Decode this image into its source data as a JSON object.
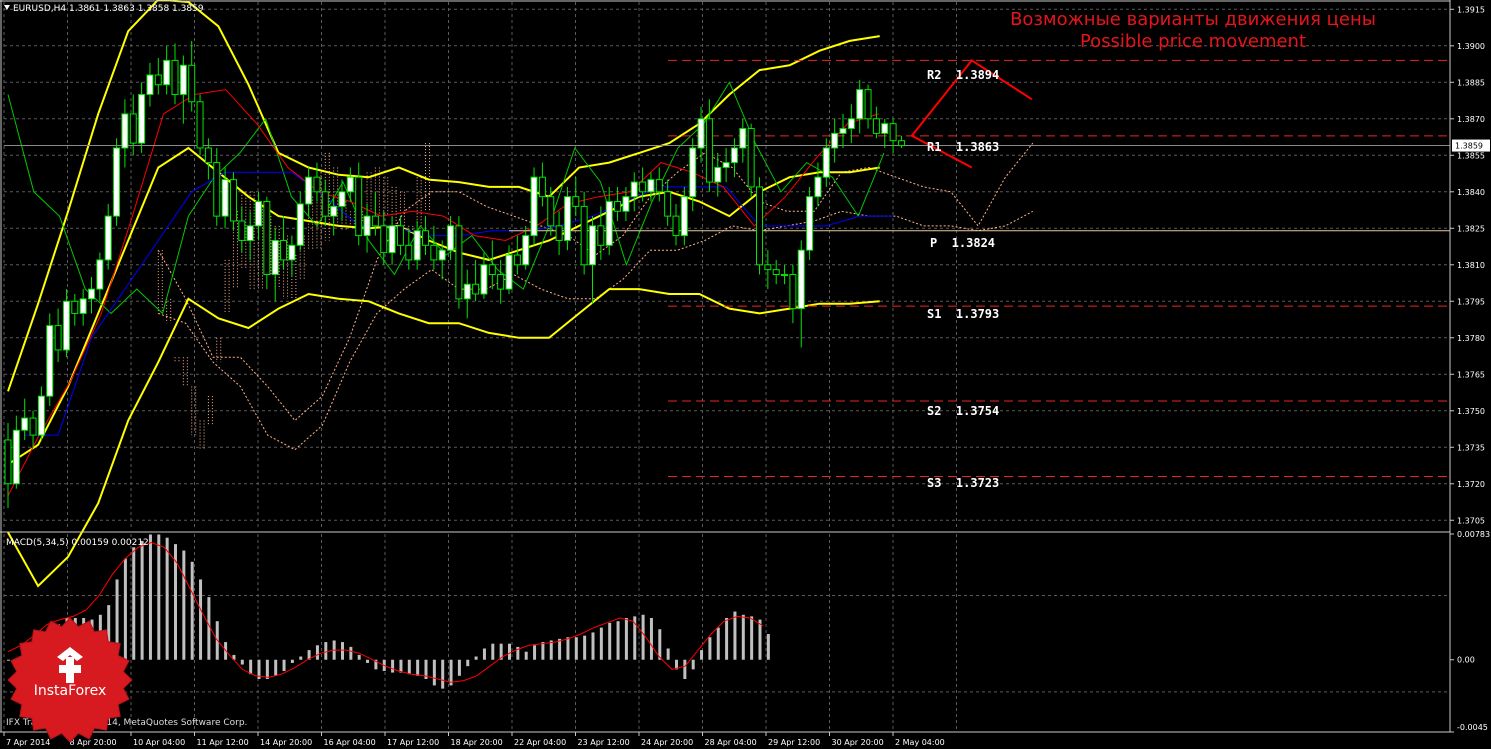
{
  "window": {
    "symbol": "EURUSD,H4",
    "ohlc": "1.3861 1.3863 1.3858 1.3859",
    "current_price": "1.3859"
  },
  "colors": {
    "background": "#000000",
    "grid": "#5a5a5a",
    "axis": "#c8c8c8",
    "bull_candle_fill": "#ffffff",
    "bear_candle_fill": "#000000",
    "candle_outline": "#00e600",
    "bollinger": "#ffff00",
    "tenkan": "#ff0000",
    "kijun": "#0000ff",
    "chikou": "#00c800",
    "cloud": "#ffb48c",
    "pivot_lines": "#e62626",
    "forecast": "#ff0000",
    "macd_hist": "#c0c0c0",
    "macd_signal": "#ff0000",
    "forecast_title": "#e6141c"
  },
  "price_axis": {
    "ticks": [
      "1.3915",
      "1.3900",
      "1.3885",
      "1.3870",
      "1.3855",
      "1.3840",
      "1.3825",
      "1.3810",
      "1.3795",
      "1.3780",
      "1.3765",
      "1.3750",
      "1.3735",
      "1.3720",
      "1.3705"
    ],
    "range": [
      1.3701,
      1.3918
    ]
  },
  "time_axis": {
    "labels": [
      "7 Apr 2014",
      "8 Apr 20:00",
      "10 Apr 04:00",
      "11 Apr 12:00",
      "14 Apr 20:00",
      "16 Apr 04:00",
      "17 Apr 12:00",
      "18 Apr 20:00",
      "22 Apr 04:00",
      "23 Apr 12:00",
      "24 Apr 20:00",
      "28 Apr 04:00",
      "29 Apr 12:00",
      "30 Apr 20:00",
      "2 May 04:00"
    ]
  },
  "forecast_title": {
    "ru": "Возможные варианты движения цены",
    "en": "Possible price movement"
  },
  "pivots": [
    {
      "label": "R2  1.3894",
      "value": 1.3894
    },
    {
      "label": "R1  1.3863",
      "value": 1.3863
    },
    {
      "label": "P  1.3824",
      "value": 1.3824
    },
    {
      "label": "S1  1.3793",
      "value": 1.3793
    },
    {
      "label": "S2  1.3754",
      "value": 1.3754
    },
    {
      "label": "S3  1.3723",
      "value": 1.3723
    }
  ],
  "macd": {
    "label": "MACD(5,34,5) 0.00159 0.00212",
    "axis_ticks": [
      "0.00783",
      "0.00",
      "-0.0045"
    ],
    "range": [
      -0.0045,
      0.00783
    ]
  },
  "footer": {
    "copyright": "IFX Trader, © 2001-2014, MetaQuotes Software Corp."
  },
  "logo": {
    "text": "InstaForex"
  },
  "chart_data": {
    "type": "candlestick",
    "symbol": "EURUSD",
    "timeframe": "H4",
    "ylim": [
      1.3701,
      1.3918
    ],
    "candles": [
      [
        1.3738,
        1.3745,
        1.371,
        1.372
      ],
      [
        1.372,
        1.3748,
        1.3718,
        1.3742
      ],
      [
        1.3742,
        1.3755,
        1.3738,
        1.3747
      ],
      [
        1.3747,
        1.375,
        1.3735,
        1.374
      ],
      [
        1.374,
        1.376,
        1.3738,
        1.3756
      ],
      [
        1.3756,
        1.379,
        1.3752,
        1.3785
      ],
      [
        1.3785,
        1.3792,
        1.377,
        1.3775
      ],
      [
        1.3775,
        1.38,
        1.3772,
        1.3795
      ],
      [
        1.3795,
        1.3798,
        1.3785,
        1.379
      ],
      [
        1.379,
        1.38,
        1.3785,
        1.3796
      ],
      [
        1.3796,
        1.3805,
        1.379,
        1.38
      ],
      [
        1.38,
        1.3815,
        1.3795,
        1.3812
      ],
      [
        1.3812,
        1.3835,
        1.3808,
        1.383
      ],
      [
        1.383,
        1.3862,
        1.3826,
        1.3858
      ],
      [
        1.3858,
        1.3878,
        1.385,
        1.3872
      ],
      [
        1.3872,
        1.388,
        1.3855,
        1.386
      ],
      [
        1.386,
        1.3885,
        1.3856,
        1.388
      ],
      [
        1.388,
        1.3893,
        1.3875,
        1.3888
      ],
      [
        1.3888,
        1.3895,
        1.388,
        1.3884
      ],
      [
        1.3884,
        1.39,
        1.388,
        1.3894
      ],
      [
        1.3894,
        1.3901,
        1.3876,
        1.388
      ],
      [
        1.388,
        1.3896,
        1.3868,
        1.3892
      ],
      [
        1.3892,
        1.3902,
        1.3873,
        1.3877
      ],
      [
        1.3877,
        1.388,
        1.3855,
        1.3858
      ],
      [
        1.3858,
        1.3862,
        1.3845,
        1.3852
      ],
      [
        1.3852,
        1.3858,
        1.3826,
        1.383
      ],
      [
        1.383,
        1.385,
        1.3825,
        1.3845
      ],
      [
        1.3845,
        1.3848,
        1.3824,
        1.3828
      ],
      [
        1.3828,
        1.3834,
        1.3815,
        1.382
      ],
      [
        1.382,
        1.3832,
        1.3812,
        1.3826
      ],
      [
        1.3826,
        1.384,
        1.382,
        1.3836
      ],
      [
        1.3836,
        1.3838,
        1.38,
        1.3806
      ],
      [
        1.3806,
        1.3825,
        1.3795,
        1.382
      ],
      [
        1.382,
        1.383,
        1.3808,
        1.3812
      ],
      [
        1.3812,
        1.3822,
        1.3805,
        1.3818
      ],
      [
        1.3818,
        1.384,
        1.3816,
        1.3835
      ],
      [
        1.3835,
        1.385,
        1.383,
        1.3846
      ],
      [
        1.3846,
        1.3852,
        1.3836,
        1.384
      ],
      [
        1.384,
        1.3845,
        1.3826,
        1.383
      ],
      [
        1.383,
        1.3838,
        1.3822,
        1.3834
      ],
      [
        1.3834,
        1.3845,
        1.3828,
        1.384
      ],
      [
        1.384,
        1.385,
        1.3836,
        1.3846
      ],
      [
        1.3846,
        1.3852,
        1.3818,
        1.3822
      ],
      [
        1.3822,
        1.3835,
        1.3815,
        1.383
      ],
      [
        1.383,
        1.384,
        1.3822,
        1.3826
      ],
      [
        1.3826,
        1.3832,
        1.381,
        1.3815
      ],
      [
        1.3815,
        1.383,
        1.381,
        1.3826
      ],
      [
        1.3826,
        1.383,
        1.3814,
        1.3818
      ],
      [
        1.3818,
        1.3825,
        1.3808,
        1.3812
      ],
      [
        1.3812,
        1.3828,
        1.3808,
        1.3824
      ],
      [
        1.3824,
        1.383,
        1.3814,
        1.3818
      ],
      [
        1.3818,
        1.3826,
        1.3808,
        1.3812
      ],
      [
        1.3812,
        1.382,
        1.3804,
        1.3816
      ],
      [
        1.3816,
        1.383,
        1.3812,
        1.3826
      ],
      [
        1.3826,
        1.383,
        1.3792,
        1.3796
      ],
      [
        1.3796,
        1.3808,
        1.3788,
        1.3802
      ],
      [
        1.3802,
        1.3812,
        1.3795,
        1.3798
      ],
      [
        1.3798,
        1.3815,
        1.3796,
        1.381
      ],
      [
        1.381,
        1.382,
        1.38,
        1.3806
      ],
      [
        1.3806,
        1.3812,
        1.3794,
        1.38
      ],
      [
        1.38,
        1.3818,
        1.3798,
        1.3814
      ],
      [
        1.3814,
        1.3822,
        1.3806,
        1.381
      ],
      [
        1.381,
        1.3826,
        1.3808,
        1.3822
      ],
      [
        1.3822,
        1.385,
        1.3818,
        1.3846
      ],
      [
        1.3846,
        1.3852,
        1.3834,
        1.3838
      ],
      [
        1.3838,
        1.3842,
        1.3822,
        1.3826
      ],
      [
        1.3826,
        1.3832,
        1.3814,
        1.382
      ],
      [
        1.382,
        1.3842,
        1.3816,
        1.3838
      ],
      [
        1.3838,
        1.3846,
        1.383,
        1.3834
      ],
      [
        1.3834,
        1.384,
        1.3806,
        1.381
      ],
      [
        1.381,
        1.383,
        1.3794,
        1.3826
      ],
      [
        1.3826,
        1.3834,
        1.3812,
        1.3818
      ],
      [
        1.3818,
        1.3842,
        1.3814,
        1.3836
      ],
      [
        1.3836,
        1.3842,
        1.3828,
        1.3832
      ],
      [
        1.3832,
        1.3842,
        1.3828,
        1.3838
      ],
      [
        1.3838,
        1.3848,
        1.3832,
        1.3844
      ],
      [
        1.3844,
        1.385,
        1.3836,
        1.384
      ],
      [
        1.384,
        1.3848,
        1.3836,
        1.3845
      ],
      [
        1.3845,
        1.385,
        1.3836,
        1.384
      ],
      [
        1.384,
        1.3845,
        1.3826,
        1.383
      ],
      [
        1.383,
        1.3835,
        1.3818,
        1.3822
      ],
      [
        1.3822,
        1.3842,
        1.3818,
        1.3838
      ],
      [
        1.3838,
        1.3862,
        1.3832,
        1.3858
      ],
      [
        1.3858,
        1.3875,
        1.3852,
        1.387
      ],
      [
        1.387,
        1.3878,
        1.384,
        1.3844
      ],
      [
        1.3844,
        1.3856,
        1.3838,
        1.385
      ],
      [
        1.385,
        1.3858,
        1.3844,
        1.3852
      ],
      [
        1.3852,
        1.3862,
        1.3846,
        1.3858
      ],
      [
        1.3858,
        1.387,
        1.3852,
        1.3866
      ],
      [
        1.3866,
        1.3868,
        1.3838,
        1.3842
      ],
      [
        1.3842,
        1.3846,
        1.3806,
        1.381
      ],
      [
        1.381,
        1.3816,
        1.38,
        1.3808
      ],
      [
        1.3808,
        1.3812,
        1.3802,
        1.3806
      ],
      [
        1.3806,
        1.381,
        1.3802,
        1.3806
      ],
      [
        1.3806,
        1.381,
        1.3786,
        1.3792
      ],
      [
        1.3792,
        1.382,
        1.3776,
        1.3816
      ],
      [
        1.3816,
        1.3842,
        1.3812,
        1.3838
      ],
      [
        1.3838,
        1.3852,
        1.3834,
        1.3846
      ],
      [
        1.3846,
        1.3862,
        1.3842,
        1.3858
      ],
      [
        1.3858,
        1.387,
        1.3852,
        1.3864
      ],
      [
        1.3864,
        1.3872,
        1.3858,
        1.3866
      ],
      [
        1.3866,
        1.3876,
        1.386,
        1.387
      ],
      [
        1.387,
        1.3886,
        1.3864,
        1.3882
      ],
      [
        1.3882,
        1.3884,
        1.3866,
        1.387
      ],
      [
        1.387,
        1.3875,
        1.3862,
        1.3864
      ],
      [
        1.3864,
        1.387,
        1.3858,
        1.3868
      ],
      [
        1.3868,
        1.387,
        1.3856,
        1.3861
      ],
      [
        1.3861,
        1.3863,
        1.3858,
        1.3859
      ]
    ],
    "bollinger_upper": [
      1.3758,
      1.3794,
      1.3832,
      1.3872,
      1.3906,
      1.3919,
      1.3918,
      1.3908,
      1.3884,
      1.3856,
      1.385,
      1.3847,
      1.3846,
      1.385,
      1.3845,
      1.3844,
      1.3842,
      1.3842,
      1.3838,
      1.385,
      1.3852,
      1.3856,
      1.386,
      1.3868,
      1.388,
      1.389,
      1.3892,
      1.3898,
      1.3902,
      1.3904
    ],
    "bollinger_middle": [
      1.3728,
      1.3736,
      1.376,
      1.379,
      1.382,
      1.385,
      1.3858,
      1.3848,
      1.3838,
      1.383,
      1.3828,
      1.3826,
      1.3825,
      1.3826,
      1.382,
      1.3815,
      1.3812,
      1.3816,
      1.382,
      1.3826,
      1.3832,
      1.3838,
      1.384,
      1.3836,
      1.383,
      1.384,
      1.3846,
      1.3848,
      1.3848,
      1.385
    ],
    "bollinger_lower": [
      1.37,
      1.3678,
      1.369,
      1.3712,
      1.3746,
      1.377,
      1.3796,
      1.3788,
      1.3784,
      1.3792,
      1.3798,
      1.3796,
      1.3795,
      1.379,
      1.3786,
      1.3786,
      1.3782,
      1.378,
      1.378,
      1.379,
      1.38,
      1.38,
      1.3798,
      1.3798,
      1.3792,
      1.379,
      1.3792,
      1.3794,
      1.3794,
      1.3795
    ],
    "tenkan": [
      1.3715,
      1.374,
      1.3762,
      1.379,
      1.383,
      1.3872,
      1.388,
      1.3882,
      1.3868,
      1.385,
      1.384,
      1.3836,
      1.383,
      1.3832,
      1.383,
      1.3822,
      1.382,
      1.3826,
      1.3835,
      1.3838,
      1.384,
      1.3852,
      1.3848,
      1.3842,
      1.3826,
      1.3838,
      1.3854,
      1.3868,
      1.3872
    ],
    "kijun": [
      1.374,
      1.374,
      1.378,
      1.38,
      1.382,
      1.384,
      1.3848,
      1.3848,
      1.3848,
      1.3838,
      1.3826,
      1.3826,
      1.3822,
      1.3822,
      1.3824,
      1.3824,
      1.3826,
      1.383,
      1.3836,
      1.3842,
      1.3842,
      1.3842,
      1.3826,
      1.3826,
      1.3826,
      1.383,
      1.383
    ],
    "chikou": [
      1.388,
      1.384,
      1.383,
      1.38,
      1.379,
      1.38,
      1.379,
      1.383,
      1.3846,
      1.3856,
      1.387,
      1.3838,
      1.3826,
      1.3844,
      1.382,
      1.3806,
      1.3826,
      1.3814,
      1.3822,
      1.3808,
      1.38,
      1.3826,
      1.3858,
      1.3844,
      1.381,
      1.3836,
      1.3858,
      1.3868,
      1.3885,
      1.386,
      1.384,
      1.3852,
      1.3846,
      1.383,
      1.3856
    ],
    "cloud_a": [
      1.3816,
      1.3796,
      1.3772,
      1.3772,
      1.376,
      1.3746,
      1.3756,
      1.378,
      1.3812,
      1.3832,
      1.384,
      1.384,
      1.3834,
      1.383,
      1.3826,
      1.3822,
      1.3814,
      1.3822,
      1.3838,
      1.3848,
      1.3856,
      1.385,
      1.3836,
      1.3832,
      1.3832,
      1.3848,
      1.385,
      1.3846,
      1.3842,
      1.384,
      1.3826,
      1.3846,
      1.386
    ],
    "cloud_b": [
      1.379,
      1.3786,
      1.377,
      1.376,
      1.374,
      1.3734,
      1.3744,
      1.377,
      1.379,
      1.38,
      1.3808,
      1.38,
      1.38,
      1.3806,
      1.38,
      1.3796,
      1.3796,
      1.3804,
      1.3816,
      1.3816,
      1.382,
      1.3826,
      1.3824,
      1.3826,
      1.3828,
      1.3832,
      1.383,
      1.383,
      1.3826,
      1.3826,
      1.3824,
      1.3826,
      1.3832
    ],
    "forecast_paths": [
      {
        "name": "up",
        "points": [
          [
            1.3863,
            0
          ],
          [
            1.3894,
            1
          ],
          [
            1.3878,
            2
          ]
        ]
      },
      {
        "name": "down",
        "points": [
          [
            1.3863,
            0
          ],
          [
            1.385,
            1
          ]
        ]
      }
    ],
    "macd_histogram": [
      0.0,
      0.0001,
      0.0003,
      0.0006,
      0.0011,
      0.0015,
      0.0022,
      0.0026,
      0.0026,
      0.0026,
      0.0025,
      0.0028,
      0.0034,
      0.005,
      0.0063,
      0.007,
      0.0074,
      0.0078,
      0.0078,
      0.0076,
      0.0072,
      0.0068,
      0.0061,
      0.005,
      0.0039,
      0.0024,
      0.0011,
      0.0003,
      -0.0003,
      -0.0009,
      -0.0012,
      -0.0012,
      -0.001,
      -0.0007,
      -0.0002,
      0.0002,
      0.0006,
      0.0009,
      0.0011,
      0.0012,
      0.0011,
      0.0008,
      0.0003,
      -0.0002,
      -0.0006,
      -0.0007,
      -0.0008,
      -0.0008,
      -0.0009,
      -0.001,
      -0.0012,
      -0.0016,
      -0.0018,
      -0.0016,
      -0.001,
      -0.0004,
      0.0002,
      0.0007,
      0.001,
      0.001,
      0.001,
      0.0008,
      0.0005,
      0.0009,
      0.0011,
      0.0012,
      0.0013,
      0.0014,
      0.0014,
      0.0015,
      0.0017,
      0.002,
      0.0023,
      0.0024,
      0.0026,
      0.0027,
      0.0028,
      0.0026,
      0.0019,
      0.0007,
      -0.0006,
      -0.0012,
      -0.0006,
      0.0006,
      0.0014,
      0.002,
      0.0026,
      0.003,
      0.0028,
      0.0027,
      0.0025,
      0.0016
    ],
    "macd_signal": [
      0.0005,
      0.0009,
      0.0015,
      0.0022,
      0.0025,
      0.0027,
      0.0031,
      0.004,
      0.0053,
      0.0063,
      0.007,
      0.0073,
      0.007,
      0.006,
      0.0044,
      0.0028,
      0.0013,
      0.0003,
      -0.0006,
      -0.001,
      -0.0011,
      -0.0009,
      -0.0005,
      0.0,
      0.0004,
      0.0006,
      0.0006,
      0.0004,
      0.0,
      -0.0004,
      -0.0007,
      -0.0009,
      -0.001,
      -0.0012,
      -0.0014,
      -0.0013,
      -0.001,
      -0.0004,
      0.0002,
      0.0006,
      0.0009,
      0.001,
      0.0011,
      0.0013,
      0.0016,
      0.002,
      0.0023,
      0.0026,
      0.0024,
      0.0014,
      0.0002,
      -0.0006,
      -0.0004,
      0.0006,
      0.0016,
      0.0024,
      0.0027,
      0.0026,
      0.0021
    ]
  }
}
